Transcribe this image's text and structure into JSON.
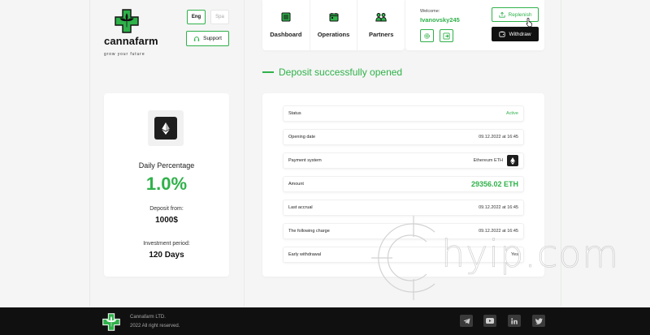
{
  "brand": {
    "name": "cannafarm",
    "tagline": "grow your future",
    "green": "#2fb14a",
    "dark": "#111111"
  },
  "header": {
    "languages": [
      {
        "label": "Eng",
        "active": true
      },
      {
        "label": "Spa",
        "active": false
      }
    ],
    "support_label": "Support",
    "nav": [
      {
        "label": "Dashboard",
        "icon": "dashboard-icon"
      },
      {
        "label": "Operations",
        "icon": "calendar-icon"
      },
      {
        "label": "Partners",
        "icon": "partners-icon"
      }
    ],
    "user": {
      "welcome": "Welcome:",
      "username": "Ivanovsky245",
      "settings_icon": "gear-icon",
      "logout_icon": "logout-icon"
    },
    "replenish_label": "Replenish",
    "withdraw_label": "Withdraw"
  },
  "deposit": {
    "heading": "Deposit successfully opened",
    "summary": {
      "currency_icon": "ethereum-icon",
      "daily_label": "Daily Percentage",
      "daily_value": "1.0%",
      "from_label": "Deposit from:",
      "from_value": "1000$",
      "period_label": "Investment period:",
      "period_value": "120 Days"
    },
    "details": [
      {
        "label": "Status",
        "value": "Active",
        "style": "green"
      },
      {
        "label": "Opening date",
        "value": "09.12.2022 at 16:45",
        "style": ""
      },
      {
        "label": "Payment system",
        "value": "Ethereum ETH",
        "style": "eth"
      },
      {
        "label": "Amount",
        "value": "29356.02 ETH",
        "style": "big"
      },
      {
        "label": "Last accrual",
        "value": "09.12.2022 at 16:45",
        "style": ""
      },
      {
        "label": "The following charge",
        "value": "09.12.2022 at 16:45",
        "style": ""
      },
      {
        "label": "Early withdrawal",
        "value": "Yes",
        "style": ""
      }
    ]
  },
  "watermark": {
    "text": "hyip.com"
  },
  "footer": {
    "company": "Cannafarm LTD.",
    "rights": "2022 All right reserved.",
    "social": [
      "telegram-icon",
      "youtube-icon",
      "linkedin-icon",
      "twitter-icon"
    ]
  }
}
